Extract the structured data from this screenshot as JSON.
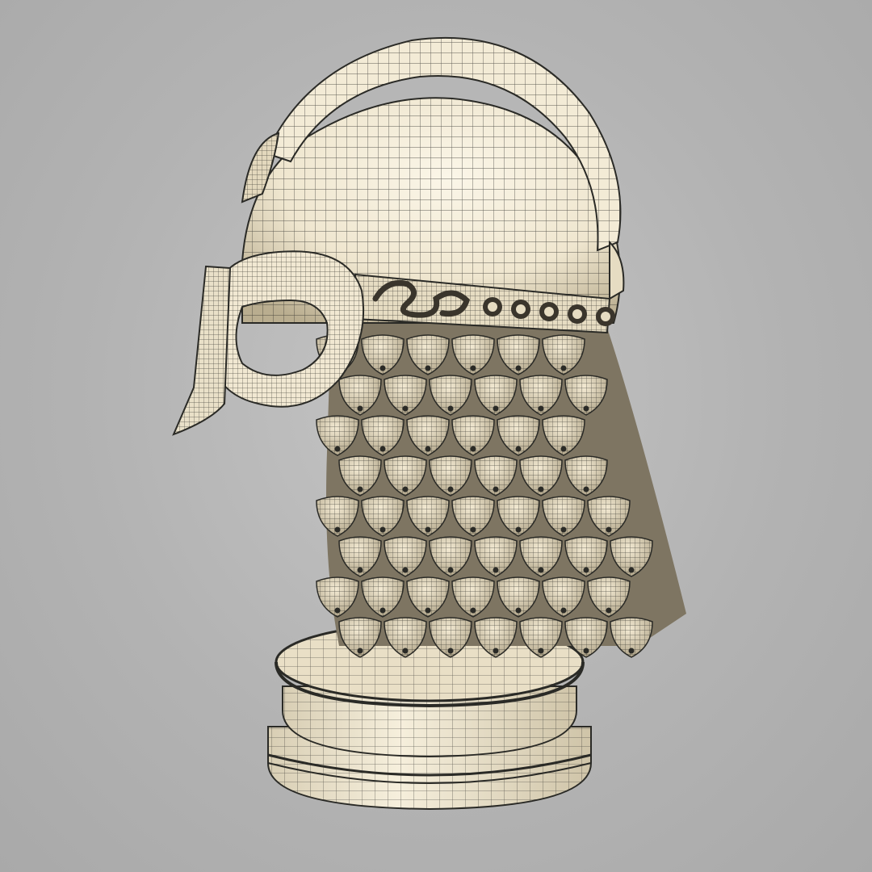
{
  "viewport": {
    "background_color": "#b8b8b8"
  },
  "model": {
    "subject": "helmet-wireframe-render",
    "shading": "wireframe-over-shaded",
    "surface_color": "#efe6cf",
    "surface_highlight": "#fbf6e8",
    "surface_shadow": "#b9ad8f",
    "wire_color": "#2a2a26",
    "mail_scale_rows": 8,
    "brow_band_rivets": 5
  }
}
